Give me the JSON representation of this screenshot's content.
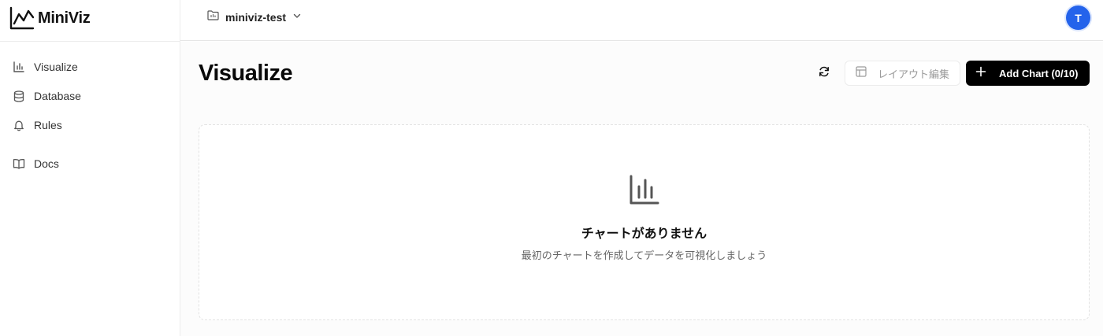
{
  "app": {
    "name": "MiniViz",
    "logo_icon": "line-chart-logo-icon"
  },
  "sidebar": {
    "items": [
      {
        "label": "Visualize",
        "icon": "bar-chart-icon"
      },
      {
        "label": "Database",
        "icon": "database-icon"
      },
      {
        "label": "Rules",
        "icon": "bell-icon"
      },
      {
        "label": "Docs",
        "icon": "book-open-icon"
      }
    ]
  },
  "header": {
    "project_name": "miniviz-test",
    "project_icon": "folder-icon",
    "dropdown_icon": "chevron-down-icon",
    "avatar_initial": "T",
    "avatar_color": "#2463eb"
  },
  "main": {
    "title": "Visualize",
    "refresh_icon": "refresh-icon",
    "layout_button_label": "レイアウト編集",
    "add_chart_label": "Add Chart (0/10)",
    "empty_state": {
      "icon": "bar-chart-icon",
      "title": "チャートがありません",
      "subtitle": "最初のチャートを作成してデータを可視化しましょう"
    }
  }
}
